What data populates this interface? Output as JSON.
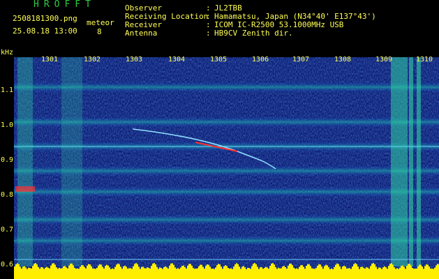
{
  "header": {
    "app_title": "HROFFT",
    "filename": "2508181300.png",
    "timestamp": "25.08.18 13:00",
    "meteor_label": "meteor",
    "meteor_count": "8"
  },
  "info": [
    {
      "label": "Observer",
      "value": "JL2TBB"
    },
    {
      "label": "Receiving Location",
      "value": "Hamamatsu, Japan (N34°40' E137°43')"
    },
    {
      "label": "Receiver",
      "value": "ICOM IC-R2500 53.1000MHz USB"
    },
    {
      "label": "Antenna",
      "value": "HB9CV Zenith dir."
    }
  ],
  "colon": ":",
  "colors": {
    "label_text": "#ffff55",
    "title_text": "#2ecc40",
    "signal_line": "#66ccff",
    "amplitude_bar": "#ffee00"
  },
  "plot": {
    "type": "spectrogram",
    "y_unit": "kHz",
    "y_ticks": [
      "1.1",
      "1.0",
      "0.9",
      "0.8",
      "0.7",
      "0.6"
    ],
    "x_ticks": [
      "1301",
      "1302",
      "1303",
      "1304",
      "1305",
      "1306",
      "1307",
      "1308",
      "1309",
      "1310"
    ],
    "reference_line_khz": 0.93
  }
}
